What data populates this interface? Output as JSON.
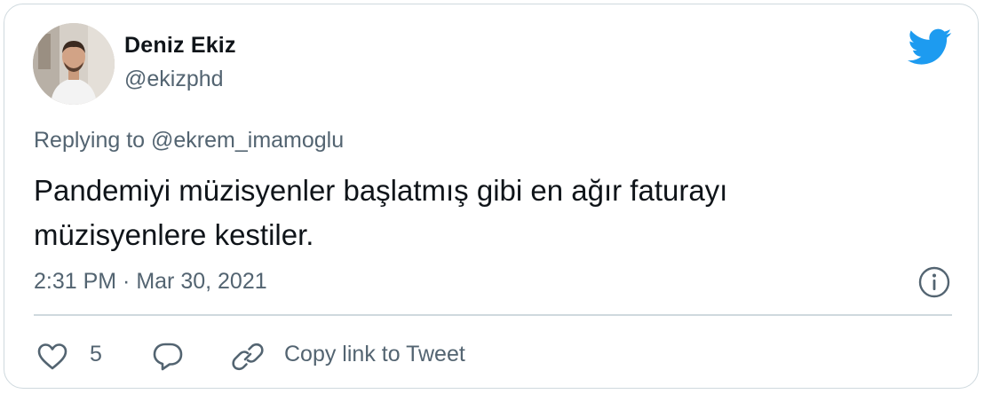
{
  "author": {
    "name": "Deniz Ekiz",
    "handle": "@ekizphd"
  },
  "reply_context": "Replying to @ekrem_imamoglu",
  "tweet": {
    "lines": [
      "Pandemiyi müzisyenler başlatmış gibi en ağır faturayı",
      "müzisyenlere kestiler."
    ],
    "timestamp": "2:31 PM · Mar 30, 2021"
  },
  "actions": {
    "like_count": "5",
    "copy_link_label": "Copy link to Tweet"
  },
  "icons": {
    "brand": "twitter-bird-icon",
    "info": "info-icon",
    "like": "heart-icon",
    "reply": "reply-bubble-icon",
    "link": "link-icon"
  },
  "colors": {
    "brand_blue": "#1d9bf0",
    "secondary_text": "#536471",
    "primary_text": "#0f1419",
    "border": "#cfd9de"
  }
}
